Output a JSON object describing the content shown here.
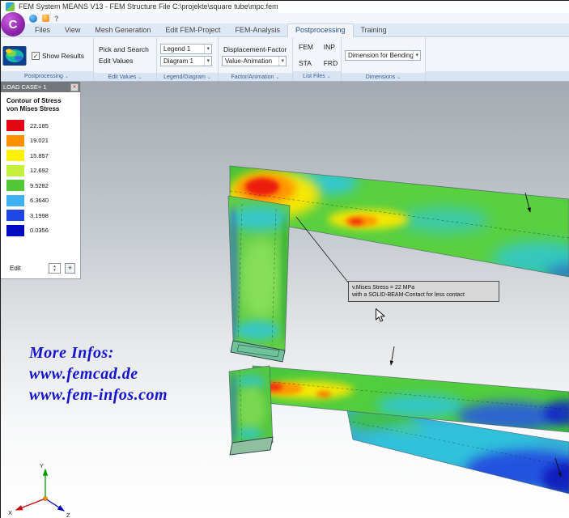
{
  "window": {
    "title": "FEM System MEANS V13 - FEM Structure File C:\\projekte\\square tube\\mpc.fem"
  },
  "icons": {
    "chevron_down": "▾",
    "group_chevron": "⌄",
    "check": "✓",
    "close": "✕",
    "question": "?",
    "plus": "+",
    "spin_up": "▴",
    "spin_down": "▾",
    "logo_letter": "C"
  },
  "tabs": [
    "Files",
    "View",
    "Mesh Generation",
    "Edit FEM-Project",
    "FEM-Analysis",
    "Postprocessing",
    "Training"
  ],
  "ribbon": {
    "postprocessing": {
      "label": "Postprocessing",
      "show_results": "Show Results"
    },
    "edit_values": {
      "label": "Edit Values",
      "pick_and_search": "Pick and Search",
      "edit_values_btn": "Edit Values"
    },
    "legend_diagram": {
      "label": "Legend/Diagram",
      "legend_select": "Legend 1",
      "diagram_select": "Diagram 1"
    },
    "factor_animation": {
      "label": "Factor/Animation",
      "displacement_factor": "Displacement-Factor",
      "value_animation": "Value-Animation"
    },
    "list_files": {
      "label": "List Files",
      "fem": "FEM",
      "inp": "INP",
      "sta": "STA",
      "frd": "FRD"
    },
    "dimensions": {
      "label": "Dimensions",
      "dimension_select": "Dimension for Bending"
    }
  },
  "legend_panel": {
    "header": "LOAD CASE= 1",
    "title_line1": "Contour of Stress",
    "title_line2": "von Mises Stress",
    "entries": [
      {
        "color": "#e30613",
        "value": "22.185"
      },
      {
        "color": "#ff9100",
        "value": "19.021"
      },
      {
        "color": "#fff200",
        "value": "15.857"
      },
      {
        "color": "#c3f03a",
        "value": "12.692"
      },
      {
        "color": "#53c837",
        "value": "9.5282"
      },
      {
        "color": "#3fb0f0",
        "value": "6.3640"
      },
      {
        "color": "#1f47e6",
        "value": "3.1998"
      },
      {
        "color": "#000ac0",
        "value": "0.0356"
      }
    ],
    "edit_label": "Edit"
  },
  "viewport": {
    "annotation": {
      "line1": "v.Mises Stress = 22 MPa",
      "line2": "with a SOLID-BEAM-Contact for less contact"
    },
    "watermark": {
      "line1": "More Infos:",
      "line2": "www.femcad.de",
      "line3": "www.fem-infos.com"
    },
    "axis_labels": {
      "x": "X",
      "y": "Y",
      "z": "Z"
    }
  }
}
